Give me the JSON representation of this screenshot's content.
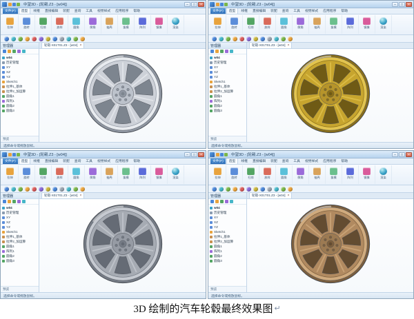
{
  "caption": {
    "text": "3D 绘制的汽车轮毂最终效果图",
    "mark": "↵"
  },
  "app": {
    "title": "中望3D - [轮毂.Z3 - [w04]]",
    "window_buttons": {
      "min": "–",
      "max": "□",
      "close": "×"
    },
    "quick_access_colors": [
      "#e8a33d",
      "#4a86d8",
      "#7ab648"
    ],
    "file_tab": "文件(F)",
    "menu_tabs": [
      "造型",
      "线框",
      "直接编辑",
      "装配",
      "查询",
      "工具",
      "视觉样式",
      "应用程序",
      "帮助"
    ],
    "ribbon_items": [
      {
        "label": "拉伸",
        "color": "#e8a33d"
      },
      {
        "label": "旋转",
        "color": "#5b8dd9"
      },
      {
        "label": "扫掠",
        "color": "#53a563"
      },
      {
        "label": "放样",
        "color": "#d96b5b"
      },
      {
        "label": "圆角",
        "color": "#5bc0d9"
      },
      {
        "label": "倒角",
        "color": "#9b6bd9"
      },
      {
        "label": "抽壳",
        "color": "#d9a35b"
      },
      {
        "label": "拔模",
        "color": "#6bbf8d"
      },
      {
        "label": "阵列",
        "color": "#5b6bd9"
      },
      {
        "label": "镜像",
        "color": "#d95b9b"
      }
    ],
    "render_label": "渲染",
    "view_ball_colors": [
      "#4a86d8",
      "#45b6c8",
      "#7ab648",
      "#e8a33d",
      "#d95b5b",
      "#8a6bd9",
      "#c8b43a",
      "#4a86d8",
      "#9aa4b0",
      "#45b6c8",
      "#7ab648",
      "#e8a33d"
    ],
    "doc_tab": {
      "label": "轮毂-X01T01.Z3 - [w04]",
      "close": "×"
    },
    "tree": {
      "header": "管理器",
      "icon_colors": [
        "#4a86d8",
        "#e8a33d",
        "#53a563",
        "#9b6bd9",
        "#45b6c8"
      ],
      "root": "w04",
      "items": [
        {
          "label": "历史管理",
          "color": "#8a9bb0"
        },
        {
          "label": "XY",
          "color": "#5b8dd9"
        },
        {
          "label": "XZ",
          "color": "#5b8dd9"
        },
        {
          "label": "YZ",
          "color": "#5b8dd9"
        },
        {
          "label": "Sketch1",
          "color": "#e8a33d"
        },
        {
          "label": "拉伸1_基体",
          "color": "#c89050"
        },
        {
          "label": "拉伸2_加运算",
          "color": "#c89050"
        },
        {
          "label": "圆角1",
          "color": "#53a563"
        },
        {
          "label": "阵列1",
          "color": "#9b6bd9"
        },
        {
          "label": "圆角2",
          "color": "#53a563"
        },
        {
          "label": "圆角3",
          "color": "#53a563"
        }
      ],
      "footer": "预览"
    },
    "status": "选择命令或拖放鼠标。"
  },
  "panels": [
    {
      "name": "silver",
      "body": "#cdd1d8",
      "shade": "#8f96a1",
      "rim": "#e8ebef",
      "hub": "#bcc2cb",
      "window": "#7d858f"
    },
    {
      "name": "gold",
      "body": "#c7a52e",
      "shade": "#8a6f1a",
      "rim": "#e2c44f",
      "hub": "#b6942a",
      "window": "#6f5a15"
    },
    {
      "name": "steel",
      "body": "#a6abb3",
      "shade": "#767c86",
      "rim": "#c6cad1",
      "hub": "#969ba4",
      "window": "#656b75"
    },
    {
      "name": "bronze",
      "body": "#b18a60",
      "shade": "#7c5f3e",
      "rim": "#d0ab7e",
      "hub": "#9c7a52",
      "window": "#634c31"
    }
  ]
}
